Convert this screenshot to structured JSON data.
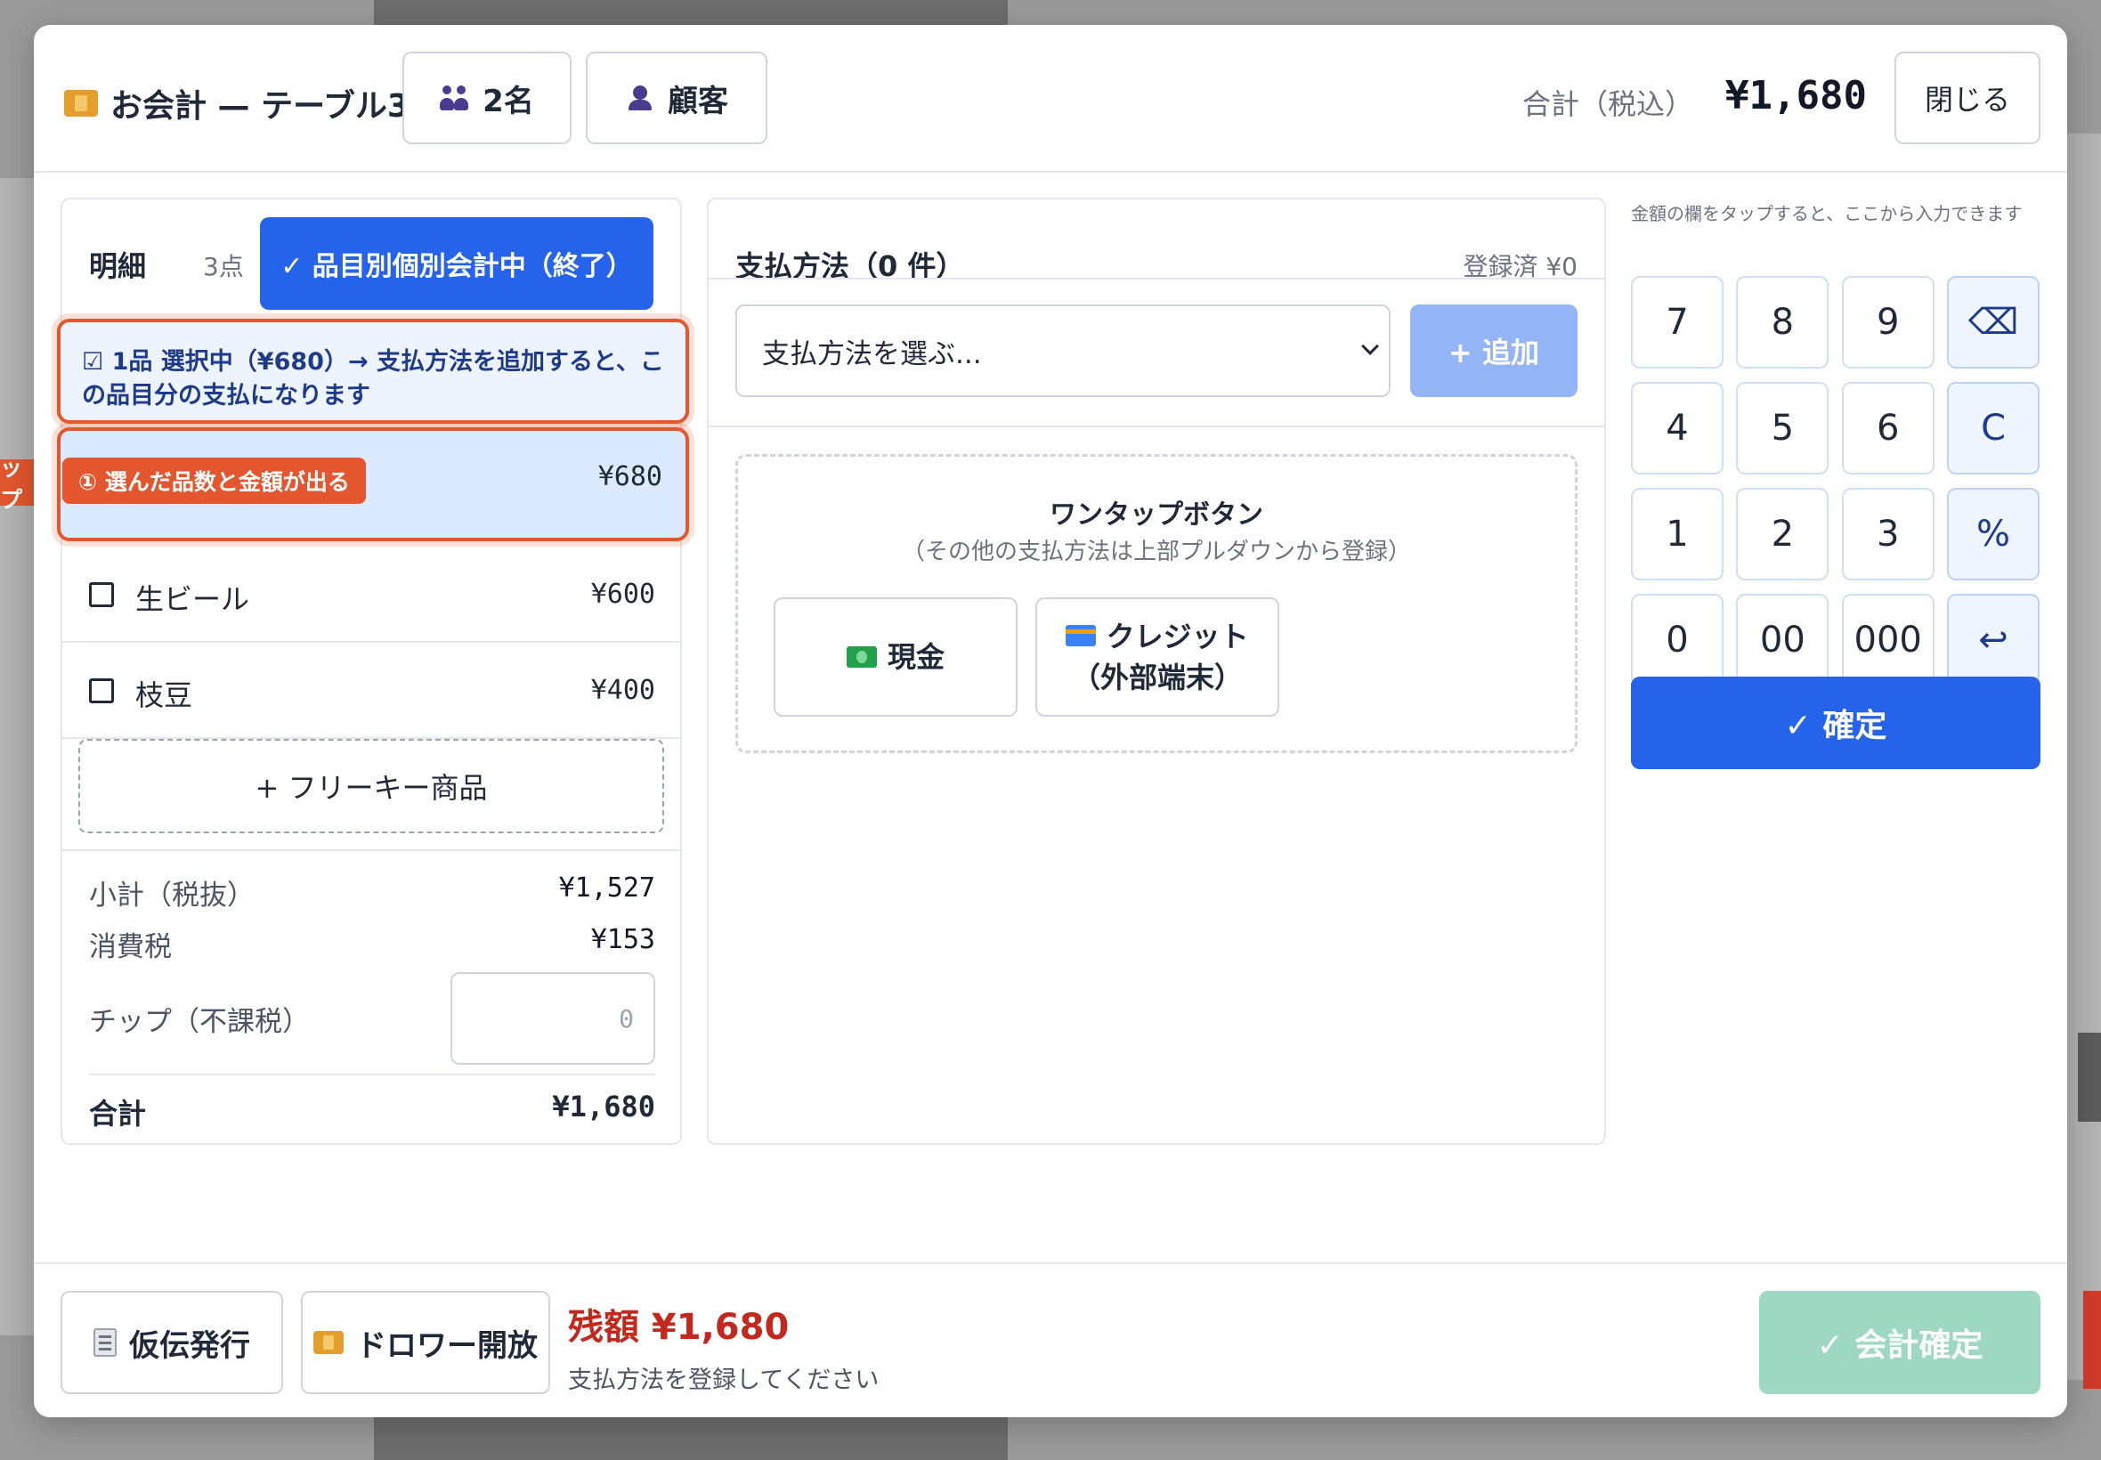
{
  "header": {
    "title": "お会計 — テーブル3",
    "guests_label": "2名",
    "customer_label": "顧客",
    "total_label": "合計（税込）",
    "total_value": "¥1,680",
    "close_label": "閉じる"
  },
  "items_panel": {
    "heading": "明細",
    "count": "3点",
    "split_button": "✓ 品目別個別会計中（終了）",
    "selection_note": "☑ 1品 選択中（¥680）→ 支払方法を追加すると、この品目分の支払になります",
    "callout": "① 選んだ品数と金額が出る",
    "callout_left": "ップ",
    "selected_row_price": "¥680",
    "items": [
      {
        "name": "生ビール",
        "price": "¥600"
      },
      {
        "name": "枝豆",
        "price": "¥400"
      }
    ],
    "freekey_label": "+ フリーキー商品",
    "subtotal_label": "小計（税抜）",
    "subtotal_value": "¥1,527",
    "tax_label": "消費税",
    "tax_value": "¥153",
    "tip_label": "チップ（不課税）",
    "tip_placeholder": "0",
    "grand_label": "合計",
    "grand_value": "¥1,680"
  },
  "payment_panel": {
    "heading": "支払方法（0 件）",
    "registered": "登録済 ¥0",
    "select_placeholder": "支払方法を選ぶ...",
    "add_label": "+ 追加",
    "onetap_title": "ワンタップボタン",
    "onetap_sub": "（その他の支払方法は上部プルダウンから登録）",
    "cash_label": "現金",
    "credit_line1": "クレジット",
    "credit_line2": "（外部端末）"
  },
  "keypad": {
    "hint": "金額の欄をタップすると、ここから入力できます",
    "keys": [
      "7",
      "8",
      "9",
      "⌫",
      "4",
      "5",
      "6",
      "C",
      "1",
      "2",
      "3",
      "%",
      "0",
      "00",
      "000",
      "↩"
    ],
    "confirm_label": "✓ 確定"
  },
  "footer": {
    "slip_label": "仮伝発行",
    "drawer_label": "ドロワー開放",
    "remaining": "残額 ¥1,680",
    "remaining_note": "支払方法を登録してください",
    "final_label": "✓ 会計確定"
  }
}
